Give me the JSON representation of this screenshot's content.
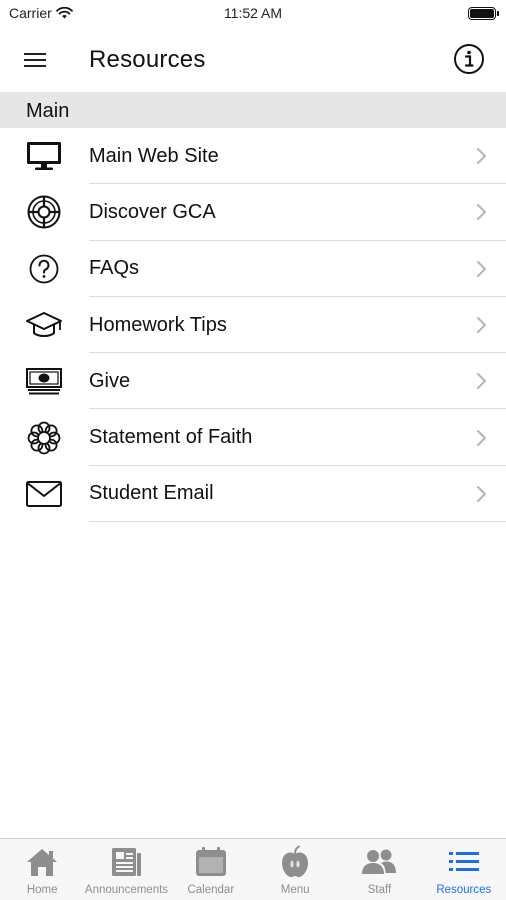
{
  "status_bar": {
    "carrier": "Carrier",
    "time": "11:52 AM"
  },
  "nav": {
    "title": "Resources",
    "menu_icon": "hamburger-menu-icon",
    "info_icon": "info-icon"
  },
  "section": {
    "title": "Main"
  },
  "items": [
    {
      "label": "Main Web Site",
      "icon": "monitor-icon"
    },
    {
      "label": "Discover GCA",
      "icon": "lifebuoy-icon"
    },
    {
      "label": "FAQs",
      "icon": "question-circle-icon"
    },
    {
      "label": "Homework Tips",
      "icon": "graduation-cap-icon"
    },
    {
      "label": "Give",
      "icon": "money-icon"
    },
    {
      "label": "Statement of Faith",
      "icon": "flower-icon"
    },
    {
      "label": "Student Email",
      "icon": "envelope-icon"
    }
  ],
  "tabs": [
    {
      "label": "Home",
      "icon": "home-icon",
      "active": false
    },
    {
      "label": "Announcements",
      "icon": "newspaper-icon",
      "active": false
    },
    {
      "label": "Calendar",
      "icon": "calendar-icon",
      "active": false
    },
    {
      "label": "Menu",
      "icon": "apple-icon",
      "active": false
    },
    {
      "label": "Staff",
      "icon": "people-icon",
      "active": false
    },
    {
      "label": "Resources",
      "icon": "list-icon",
      "active": true
    }
  ],
  "colors": {
    "accent": "#1e6ff0",
    "inactive": "#8e8e8e",
    "section_bg": "#e6e6e6",
    "tabbar_bg": "#f7f7f7"
  }
}
